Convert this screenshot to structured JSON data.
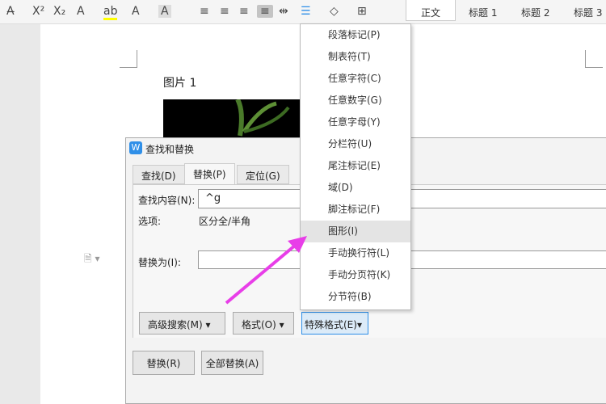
{
  "toolbar": {
    "icons": [
      "strikethrough-icon",
      "superscript-icon",
      "subscript-icon",
      "text-effect-icon",
      "highlight-icon",
      "font-color-icon",
      "char-shading-icon",
      "align-left-icon",
      "align-center-icon",
      "align-right-icon",
      "justify-icon",
      "distribute-icon",
      "line-spacing-icon",
      "fill-icon",
      "border-icon"
    ],
    "glyphs": [
      "A̶",
      "X²",
      "X₂",
      "A",
      "ab",
      "A",
      "A",
      "≡",
      "≡",
      "≡",
      "≡",
      "⇹",
      "☰",
      "◇",
      "⊞"
    ],
    "styles": [
      "正文",
      "标题 1",
      "标题 2",
      "标题 3"
    ]
  },
  "document": {
    "caption": "图片 1"
  },
  "dialog": {
    "title": "查找和替换",
    "tabs": [
      "查找(D)",
      "替换(P)",
      "定位(G)"
    ],
    "find_label": "查找内容(N):",
    "find_value": "^g",
    "options_label": "选项:",
    "options_value": "区分全/半角",
    "replace_label": "替换为(I):",
    "replace_value": "",
    "advanced_button": "高级搜索(M)",
    "format_button": "格式(O)",
    "special_button": "特殊格式(E)",
    "replace_button": "替换(R)",
    "replace_all_button": "全部替换(A)"
  },
  "menu": {
    "items": [
      "段落标记(P)",
      "制表符(T)",
      "任意字符(C)",
      "任意数字(G)",
      "任意字母(Y)",
      "分栏符(U)",
      "尾注标记(E)",
      "域(D)",
      "脚注标记(F)",
      "图形(I)",
      "手动换行符(L)",
      "手动分页符(K)",
      "分节符(B)"
    ],
    "highlighted": "图形(I)"
  },
  "colors": {
    "arrow": "#e83ee8",
    "accent": "#2f8fe8"
  }
}
